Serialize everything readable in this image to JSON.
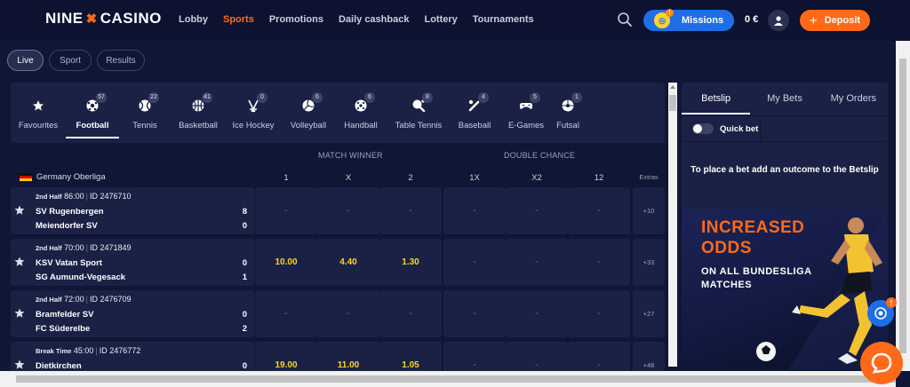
{
  "brand": {
    "left": "NINE",
    "right": "CASINO"
  },
  "nav": [
    "Lobby",
    "Sports",
    "Promotions",
    "Daily cashback",
    "Lottery",
    "Tournaments"
  ],
  "header": {
    "missions": "Missions",
    "missions_badge": "!",
    "balance": "0 €",
    "deposit": "Deposit"
  },
  "modes": [
    "Live",
    "Sport",
    "Results"
  ],
  "sports": [
    {
      "name": "Favourites",
      "icon": "star-icon",
      "count": ""
    },
    {
      "name": "Football",
      "icon": "football-icon",
      "count": "57"
    },
    {
      "name": "Tennis",
      "icon": "tennis-icon",
      "count": "22"
    },
    {
      "name": "Basketball",
      "icon": "basketball-icon",
      "count": "41"
    },
    {
      "name": "Ice Hockey",
      "icon": "ice-hockey-icon",
      "count": "0"
    },
    {
      "name": "Volleyball",
      "icon": "volleyball-icon",
      "count": "6"
    },
    {
      "name": "Handball",
      "icon": "handball-icon",
      "count": "6"
    },
    {
      "name": "Table Tennis",
      "icon": "table-tennis-icon",
      "count": "8"
    },
    {
      "name": "Baseball",
      "icon": "baseball-icon",
      "count": "4"
    },
    {
      "name": "E-Games",
      "icon": "gamepad-icon",
      "count": "5"
    },
    {
      "name": "Futsal",
      "icon": "futsal-icon",
      "count": "1"
    }
  ],
  "markets": {
    "match_winner": "MATCH WINNER",
    "double_chance": "DOUBLE CHANCE"
  },
  "league": "Germany Oberliga",
  "columns": [
    "1",
    "X",
    "2",
    "1X",
    "X2",
    "12",
    "Extras"
  ],
  "events": [
    {
      "phase": "2nd Half",
      "minute": "86:00",
      "id": "ID 2476710",
      "home": "SV Rugenbergen",
      "away": "Meiendorfer SV",
      "home_score": "8",
      "away_score": "0",
      "odds": [
        "-",
        "-",
        "-",
        "-",
        "-",
        "-"
      ],
      "extras": "+10"
    },
    {
      "phase": "2nd Half",
      "minute": "70:00",
      "id": "ID 2471849",
      "home": "KSV Vatan Sport",
      "away": "SG Aumund-Vegesack",
      "home_score": "0",
      "away_score": "1",
      "odds": [
        "10.00",
        "4.40",
        "1.30",
        "-",
        "-",
        "-"
      ],
      "extras": "+33"
    },
    {
      "phase": "2nd Half",
      "minute": "72:00",
      "id": "ID 2476709",
      "home": "Bramfelder SV",
      "away": "FC Süderelbe",
      "home_score": "0",
      "away_score": "2",
      "odds": [
        "-",
        "-",
        "-",
        "-",
        "-",
        "-"
      ],
      "extras": "+27"
    },
    {
      "phase": "Break Time",
      "minute": "45:00",
      "id": "ID 2476772",
      "home": "Dietkirchen",
      "away": "",
      "home_score": "0",
      "away_score": "",
      "odds": [
        "19.00",
        "11.00",
        "1.05",
        "-",
        "-",
        "-"
      ],
      "extras": "+48"
    }
  ],
  "betslip": {
    "tabs": [
      "Betslip",
      "My Bets",
      "My Orders"
    ],
    "quick_bet": "Quick bet",
    "empty": "To place a bet add an outcome to the Betslip"
  },
  "promo": {
    "line1": "INCREASED",
    "line2": "ODDS",
    "line3": "ON ALL BUNDESLIGA",
    "line4": "MATCHES"
  },
  "colors": {
    "accent": "#ff6a1a",
    "primary": "#1e6ee8",
    "odds": "#ffd22e",
    "bg": "#0f1636",
    "panel": "#1a2145"
  }
}
